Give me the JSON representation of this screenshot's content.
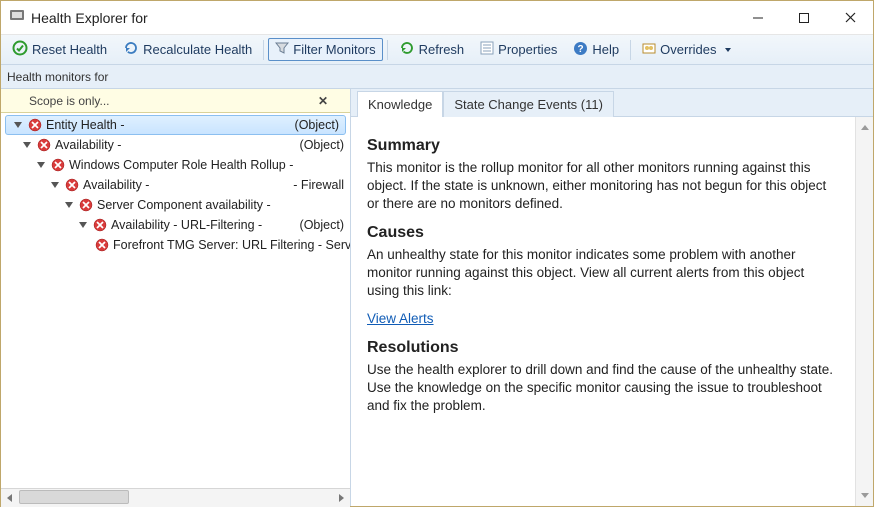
{
  "window": {
    "title": "Health Explorer for"
  },
  "toolbar": {
    "reset": "Reset Health",
    "recalc": "Recalculate Health",
    "filter": "Filter Monitors",
    "refresh": "Refresh",
    "props": "Properties",
    "help": "Help",
    "overrides": "Overrides"
  },
  "subheader": "Health monitors for",
  "scope": {
    "label": "Scope is only..."
  },
  "tree": {
    "items": [
      {
        "indent": 0,
        "expanded": true,
        "state": "error",
        "label": "Entity Health -",
        "suffix": "(Object)",
        "selected": true
      },
      {
        "indent": 1,
        "expanded": true,
        "state": "error",
        "label": "Availability -",
        "suffix": "(Object)"
      },
      {
        "indent": 2,
        "expanded": true,
        "state": "error",
        "label": "Windows Computer Role Health Rollup -",
        "suffix": ""
      },
      {
        "indent": 3,
        "expanded": true,
        "state": "error",
        "label": "Availability -",
        "suffix": "- Firewall"
      },
      {
        "indent": 4,
        "expanded": true,
        "state": "error",
        "label": "Server Component availability -",
        "suffix": ""
      },
      {
        "indent": 5,
        "expanded": true,
        "state": "error",
        "label": "Availability - URL-Filtering -",
        "suffix": "(Object)"
      },
      {
        "indent": 6,
        "expanded": null,
        "state": "error",
        "label": "Forefront TMG Server: URL Filtering - Server",
        "suffix": ""
      }
    ]
  },
  "tabs": {
    "knowledge": "Knowledge",
    "events": "State Change Events (11)"
  },
  "knowledge": {
    "summary_h": "Summary",
    "summary_p": "This monitor is the rollup monitor for all other monitors running against this object. If the state is unknown, either monitoring has not begun for this object or there are no monitors defined.",
    "causes_h": "Causes",
    "causes_p": "An unhealthy state for this monitor indicates some problem with another monitor running against this object. View all current alerts from this object using this link:",
    "view_alerts": "View Alerts",
    "resolutions_h": "Resolutions",
    "resolutions_p": "Use the health explorer to drill down and find the cause of the unhealthy state. Use the knowledge on the specific monitor causing the issue to troubleshoot and fix the problem."
  }
}
